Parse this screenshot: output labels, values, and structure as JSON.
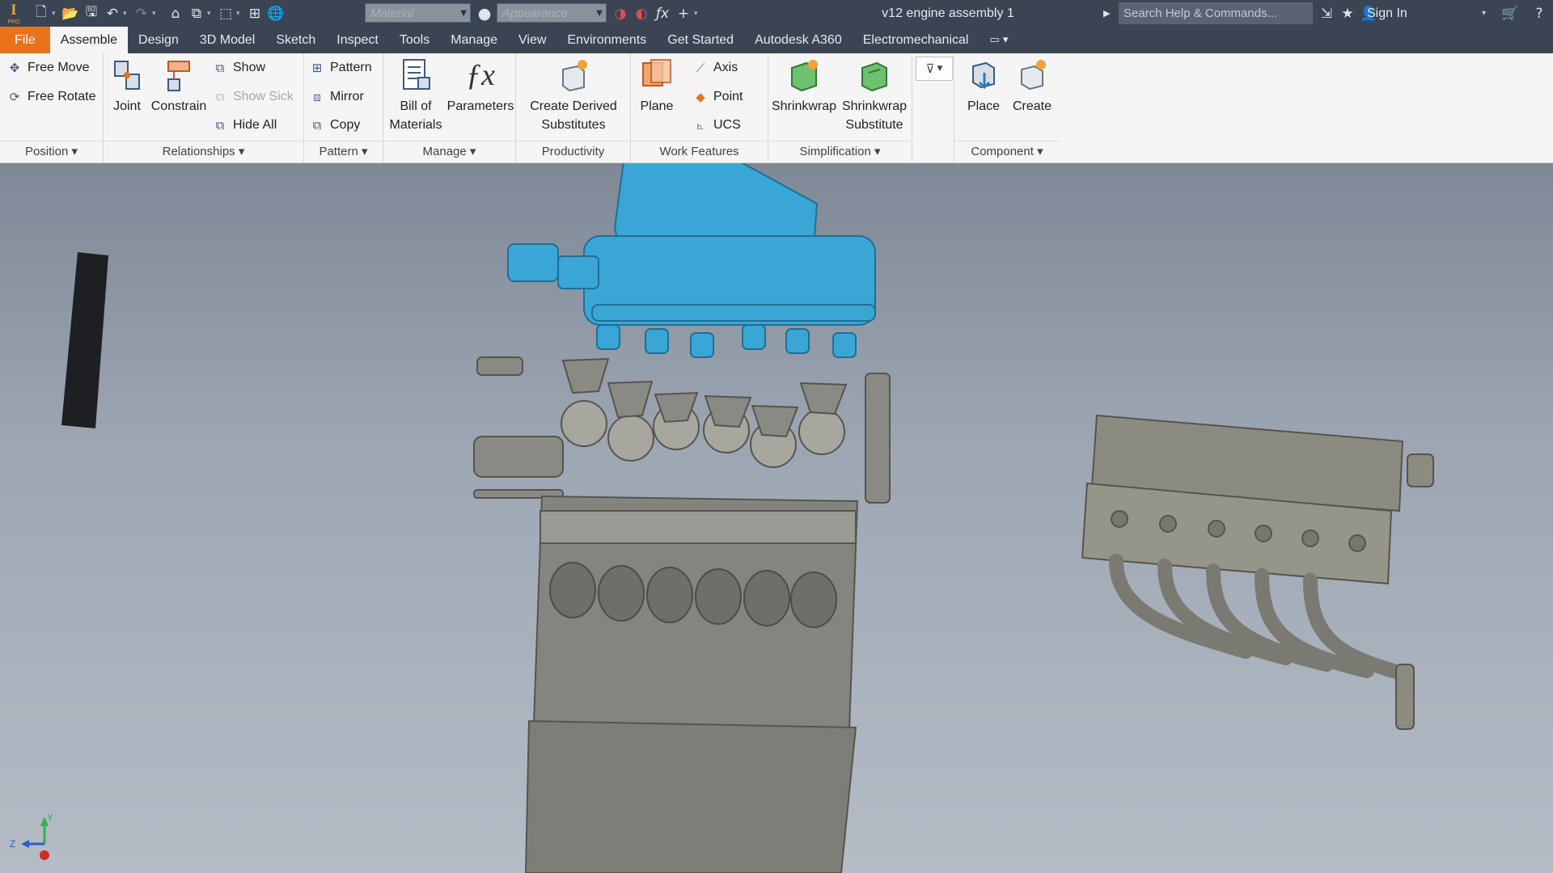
{
  "app": {
    "logo_letter": "I",
    "logo_sub": "PRO"
  },
  "toolbar": {
    "material_placeholder": "Material",
    "appearance_placeholder": "Appearance"
  },
  "title": "v12 engine assembly 1",
  "search": {
    "placeholder": "Search Help & Commands..."
  },
  "account": {
    "sign_in": "Sign In"
  },
  "tabs": [
    {
      "label": "File"
    },
    {
      "label": "Assemble"
    },
    {
      "label": "Design"
    },
    {
      "label": "3D Model"
    },
    {
      "label": "Sketch"
    },
    {
      "label": "Inspect"
    },
    {
      "label": "Tools"
    },
    {
      "label": "Manage"
    },
    {
      "label": "View"
    },
    {
      "label": "Environments"
    },
    {
      "label": "Get Started"
    },
    {
      "label": "Autodesk A360"
    },
    {
      "label": "Electromechanical"
    }
  ],
  "ribbon": {
    "position": {
      "title": "Position",
      "free_move": "Free Move",
      "free_rotate": "Free Rotate"
    },
    "relationships": {
      "title": "Relationships",
      "joint": "Joint",
      "constrain": "Constrain",
      "show": "Show",
      "show_sick": "Show Sick",
      "hide_all": "Hide All"
    },
    "pattern": {
      "title": "Pattern",
      "pattern": "Pattern",
      "mirror": "Mirror",
      "copy": "Copy"
    },
    "manage": {
      "title": "Manage",
      "bom_line1": "Bill of",
      "bom_line2": "Materials",
      "parameters": "Parameters"
    },
    "productivity": {
      "title": "Productivity",
      "derived_line1": "Create Derived",
      "derived_line2": "Substitutes"
    },
    "work_features": {
      "title": "Work Features",
      "plane": "Plane",
      "axis": "Axis",
      "point": "Point",
      "ucs": "UCS"
    },
    "simplification": {
      "title": "Simplification",
      "shrinkwrap": "Shrinkwrap",
      "sw_sub_line1": "Shrinkwrap",
      "sw_sub_line2": "Substitute"
    },
    "component": {
      "title": "Component",
      "place": "Place",
      "create": "Create"
    }
  },
  "viewcube_axes": {
    "y": "Y",
    "z": "Z"
  },
  "colors": {
    "titlebar": "#3b4453",
    "file_tab": "#e8731b",
    "selected_part": "#3aa6d6",
    "part_gray": "#8a8a84"
  }
}
